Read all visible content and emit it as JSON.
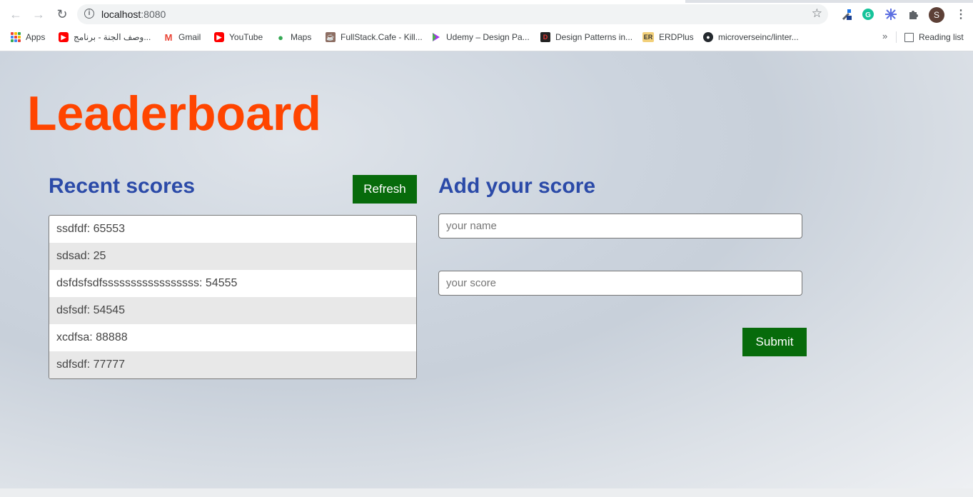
{
  "browser": {
    "url_host": "localhost",
    "url_port": ":8080",
    "avatar_letter": "S",
    "bookmarks": [
      {
        "label": "Apps",
        "icon": "apps-grid-icon"
      },
      {
        "label": "وصف الجنة - برنامج...",
        "icon": "youtube-icon",
        "color": "#ff0000"
      },
      {
        "label": "Gmail",
        "icon": "gmail-icon",
        "color": "#ea4335"
      },
      {
        "label": "YouTube",
        "icon": "youtube-icon",
        "color": "#ff0000"
      },
      {
        "label": "Maps",
        "icon": "maps-icon",
        "color": "#34a853"
      },
      {
        "label": "FullStack.Cafe - Kill...",
        "icon": "coffee-icon",
        "color": "#8d6e63"
      },
      {
        "label": "Udemy – Design Pa...",
        "icon": "udemy-icon",
        "color": "#a435f0"
      },
      {
        "label": "Design Patterns in...",
        "icon": "refactoring-icon",
        "color": "#c62828"
      },
      {
        "label": "ERDPlus",
        "icon": "erdplus-icon",
        "color": "#e6c36b"
      },
      {
        "label": "microverseinc/linter...",
        "icon": "github-icon",
        "color": "#24292e"
      }
    ],
    "more_label": "»",
    "reading_list": "Reading list"
  },
  "page": {
    "title": "Leaderboard",
    "recent": {
      "heading": "Recent scores",
      "refresh_label": "Refresh",
      "scores": [
        "ssdfdf: 65553",
        "sdsad: 25",
        "dsfdsfsdfsssssssssssssssss: 54555",
        "dsfsdf: 54545",
        "xcdfsa: 88888",
        "sdfsdf: 77777"
      ]
    },
    "form": {
      "heading": "Add your score",
      "name_placeholder": "your name",
      "score_placeholder": "your score",
      "submit_label": "Submit"
    }
  },
  "colors": {
    "title": "#ff4500",
    "heading": "#2b4aa8",
    "button": "#076b0b"
  }
}
